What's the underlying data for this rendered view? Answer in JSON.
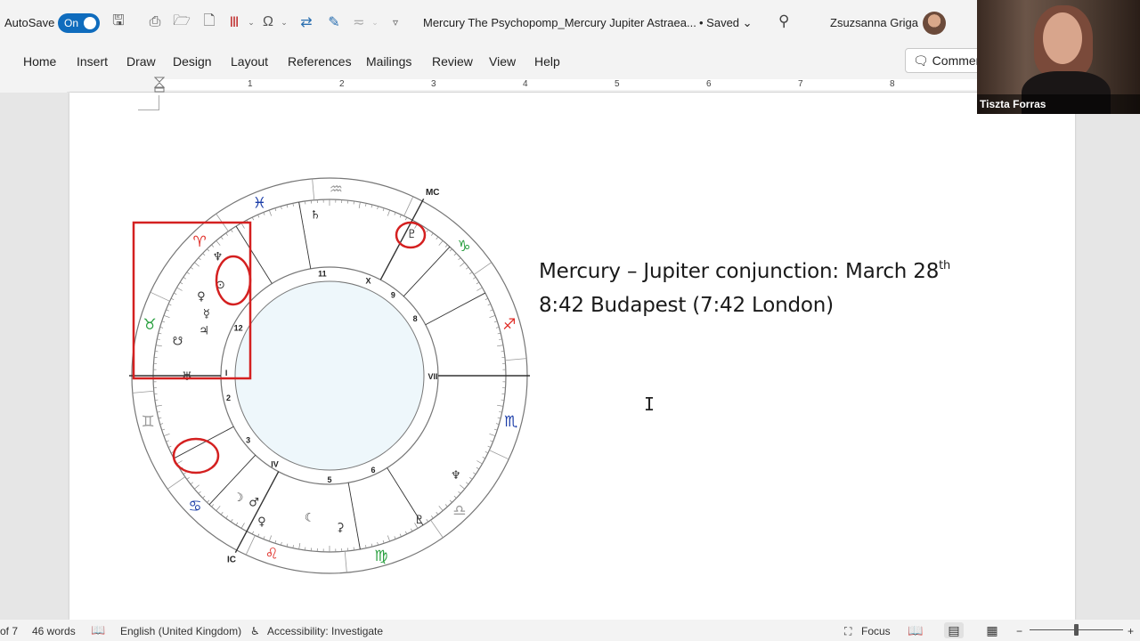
{
  "titlebar": {
    "autosave_label": "AutoSave",
    "autosave_state": "On",
    "doc_title": "Mercury The Psychopomp_Mercury Jupiter Astraea...",
    "saved_label": "• Saved",
    "user_name": "Zsuzsanna Griga"
  },
  "ribbon": {
    "tabs": [
      "Home",
      "Insert",
      "Draw",
      "Design",
      "Layout",
      "References",
      "Mailings",
      "Review",
      "View",
      "Help"
    ],
    "comments_label": "Comments"
  },
  "ruler": {
    "numbers": [
      "1",
      "2",
      "3",
      "4",
      "5",
      "6",
      "7",
      "8"
    ]
  },
  "document": {
    "heading_line1_prefix": "Mercury – Jupiter conjunction: March 28",
    "heading_line1_sup": "th",
    "heading_line2": "8:42 Budapest (7:42 London)"
  },
  "chart": {
    "angle_labels": [
      "MC",
      "IC",
      "VII"
    ],
    "house_numbers": [
      "11",
      "X",
      "9",
      "8",
      "12",
      "I",
      "2",
      "3",
      "IV",
      "5",
      "6",
      "VII"
    ],
    "sign_colors": {
      "fire": "#e0302a",
      "earth": "#2aa040",
      "air": "#9a9a9a",
      "water": "#1a3ca8"
    },
    "highlight_color": "#d42020"
  },
  "video": {
    "participant_name": "Tiszta Forras"
  },
  "status": {
    "page": "of 7",
    "words": "46 words",
    "language": "English (United Kingdom)",
    "accessibility": "Accessibility: Investigate",
    "focus": "Focus"
  },
  "colors": {
    "accent": "#0f6cbd"
  }
}
